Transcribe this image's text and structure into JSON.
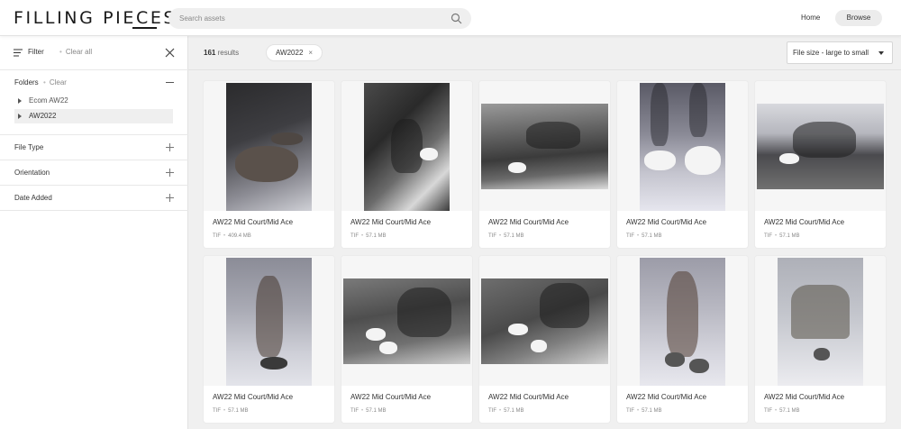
{
  "header": {
    "logo": "FILLING PIECES",
    "search_placeholder": "Search assets",
    "nav_home": "Home",
    "nav_browse": "Browse"
  },
  "sidebar": {
    "filter_title": "Filter",
    "clear_all": "Clear all",
    "folders": {
      "title": "Folders",
      "clear": "Clear",
      "items": [
        {
          "label": "Ecom AW22",
          "selected": false
        },
        {
          "label": "AW2022",
          "selected": true
        }
      ]
    },
    "sections": [
      {
        "title": "File Type"
      },
      {
        "title": "Orientation"
      },
      {
        "title": "Date Added"
      }
    ]
  },
  "results": {
    "count": "161",
    "count_label": "results",
    "active_tag": "AW2022",
    "sort_label": "File size - large to small"
  },
  "assets": [
    {
      "title": "AW22 Mid Court/Mid Ace",
      "type": "TIF",
      "size": "409.4 MB",
      "orientation": "portrait"
    },
    {
      "title": "AW22 Mid Court/Mid Ace",
      "type": "TIF",
      "size": "57.1 MB",
      "orientation": "portrait"
    },
    {
      "title": "AW22 Mid Court/Mid Ace",
      "type": "TIF",
      "size": "57.1 MB",
      "orientation": "landscape"
    },
    {
      "title": "AW22 Mid Court/Mid Ace",
      "type": "TIF",
      "size": "57.1 MB",
      "orientation": "portrait"
    },
    {
      "title": "AW22 Mid Court/Mid Ace",
      "type": "TIF",
      "size": "57.1 MB",
      "orientation": "landscape"
    },
    {
      "title": "AW22 Mid Court/Mid Ace",
      "type": "TIF",
      "size": "57.1 MB",
      "orientation": "portrait"
    },
    {
      "title": "AW22 Mid Court/Mid Ace",
      "type": "TIF",
      "size": "57.1 MB",
      "orientation": "landscape"
    },
    {
      "title": "AW22 Mid Court/Mid Ace",
      "type": "TIF",
      "size": "57.1 MB",
      "orientation": "landscape"
    },
    {
      "title": "AW22 Mid Court/Mid Ace",
      "type": "TIF",
      "size": "57.1 MB",
      "orientation": "portrait"
    },
    {
      "title": "AW22 Mid Court/Mid Ace",
      "type": "TIF",
      "size": "57.1 MB",
      "orientation": "portrait"
    }
  ],
  "icons": {
    "search": "search-icon",
    "filter": "filter-lines-icon",
    "close": "close-icon",
    "collapse": "minus-icon",
    "expand": "plus-icon",
    "folder_caret": "caret-right-icon",
    "sort_caret": "caret-down-icon",
    "tag_remove": "x-icon"
  },
  "colors": {
    "background": "#f0f0f0",
    "panel": "#ffffff",
    "text": "#333333",
    "muted": "#888888",
    "selected_row": "#efefef"
  }
}
